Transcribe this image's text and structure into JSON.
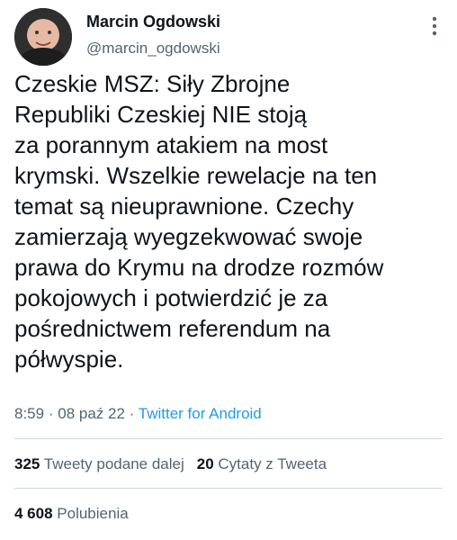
{
  "author": {
    "name": "Marcin Ogdowski",
    "handle": "@marcin_ogdowski",
    "avatar_icon": "user-avatar"
  },
  "tweet": {
    "text": "Czeskie MSZ: Siły Zbrojne\nRepubliki Czeskiej NIE stoją\nza porannym atakiem na most\nkrymski. Wszelkie rewelacje na ten\ntemat są nieuprawnione. Czechy\nzamierzają wyegzekwować swoje\nprawa do Krymu na drodze rozmów\npokojowych i potwierdzić je za\npośrednictwem referendum na\npółwyspie.",
    "time": "8:59",
    "date": "08 paź 22",
    "separator": "·",
    "source": "Twitter for Android"
  },
  "stats": {
    "retweets_count": "325",
    "retweets_label": "Tweety podane dalej",
    "quotes_count": "20",
    "quotes_label": "Cytaty z Tweeta",
    "likes_count": "4 608",
    "likes_label": "Polubienia"
  },
  "colors": {
    "text": "#0f1419",
    "secondary": "#536471",
    "link": "#1d9bf0",
    "divider": "#cfd9de"
  }
}
